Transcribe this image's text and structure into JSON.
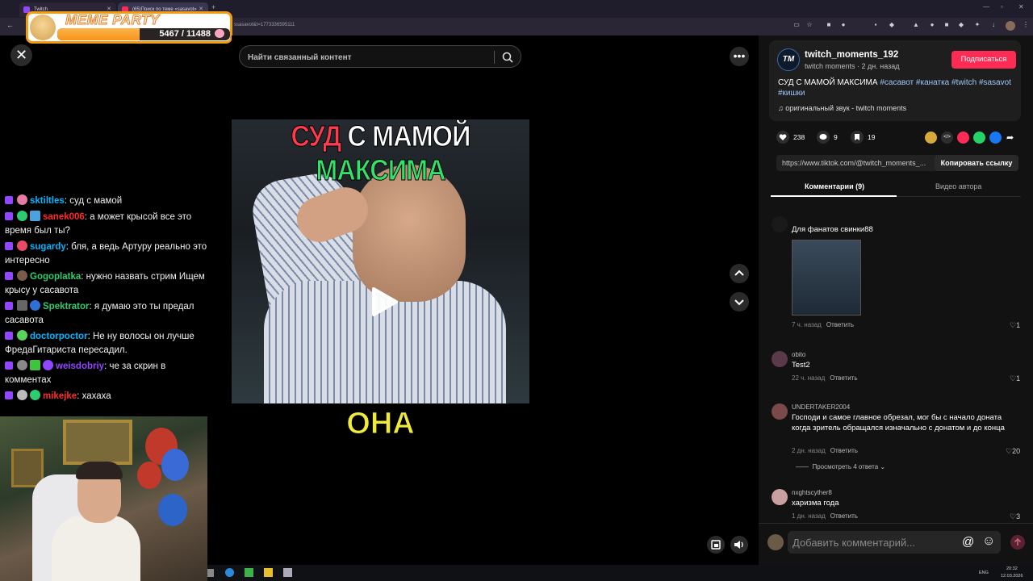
{
  "browser": {
    "tabs": [
      {
        "label": "Twitch"
      },
      {
        "label": "(65)Поиск по теме «sasavot»"
      }
    ],
    "url": "ssasavot&t=1773336595111"
  },
  "meme_party": {
    "title": "MEME PARTY",
    "count": "5467 / 11488",
    "progress_fraction": 0.476
  },
  "chat": {
    "messages": [
      {
        "user": "sktiltles",
        "user_color": "#00b5ff",
        "text": " суд с мамой"
      },
      {
        "user": "sanek006",
        "user_color": "#ff2a2a",
        "text": " а может крысой все это время был ты?"
      },
      {
        "user": "sugardy",
        "user_color": "#00b5ff",
        "text": " бля, а ведь Артуру реально это интересно"
      },
      {
        "user": "Gogoplatka",
        "user_color": "#2ecc71",
        "text": " нужно назвать стрим Ищем крысу у сасавота"
      },
      {
        "user": "Spektrator",
        "user_color": "#2ecc71",
        "text": " я думаю это ты предал сасавота"
      },
      {
        "user": "doctorpoctor",
        "user_color": "#00b5ff",
        "text": " Не ну волосы он лучше ФредаГитариста пересадил."
      },
      {
        "user": "weisdobriy",
        "user_color": "#9146ff",
        "text": " че за скрин в комментах"
      },
      {
        "user": "mikejke",
        "user_color": "#ff2a2a",
        "text": " хахаха"
      }
    ]
  },
  "search": {
    "placeholder": "Найти связанный контент"
  },
  "video": {
    "caption_top": {
      "red": "СУД",
      "white": "С МАМОЙ",
      "green": "МАКСИМА"
    },
    "caption_bottom": "ОНА"
  },
  "post": {
    "author_initials": "TM",
    "author_name": "twitch_moments_192",
    "author_meta": "twitch moments · 2 дн. назад",
    "follow_label": "Подписаться",
    "description": "СУД С МАМОЙ МАКСИМА ",
    "tags": [
      "#сасавот",
      "#канатка",
      "#twitch",
      "#sasavot",
      "#кишки"
    ],
    "music": "оригинальный звук - twitch moments",
    "likes": "238",
    "comments": "9",
    "saves": "19",
    "link": "https://www.tiktok.com/@twitch_moments_...",
    "copy_link_label": "Копировать ссылку"
  },
  "tabs": {
    "comments": "Комментарии (9)",
    "author_videos": "Видео автора"
  },
  "comments": [
    {
      "user": "",
      "text": "Для фанатов свинки88",
      "time": "7 ч. назад",
      "reply": "Ответить",
      "likes": "1"
    },
    {
      "user": "obito",
      "text": "Test2",
      "time": "22 ч. назад",
      "reply": "Ответить",
      "likes": "1"
    },
    {
      "user": "UNDERTAKER2004",
      "text": "Господи и самое главное обрезал, мог бы с начало доната когда зритель обращался изначально с донатом и до конца",
      "time": "2 дн. назад",
      "reply": "Ответить",
      "likes": "20",
      "view_replies": "Просмотреть 4 ответа"
    },
    {
      "user": "nxghtscyther8",
      "text": "харизма года",
      "time": "1 дн. назад",
      "reply": "Ответить",
      "likes": "3"
    }
  ],
  "comment_box": {
    "placeholder": "Добавить комментарий..."
  },
  "taskbar": {
    "lang": "ENG",
    "time": "20:32",
    "date": "12.03.2026"
  }
}
